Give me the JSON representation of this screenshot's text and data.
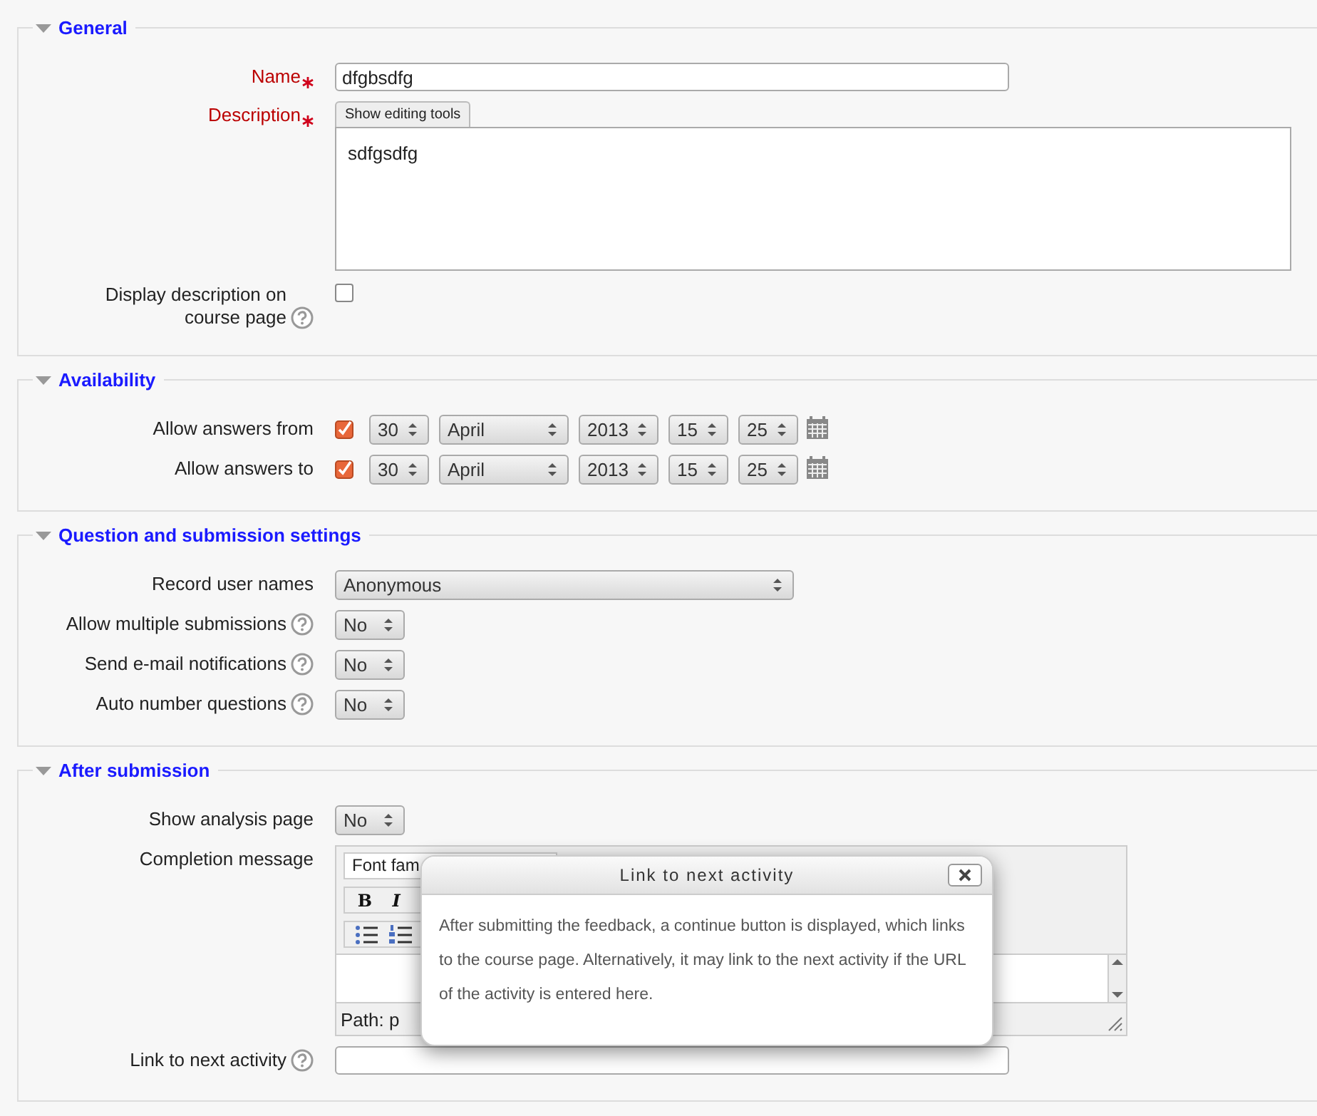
{
  "sections": [
    {
      "title": "General",
      "expanded": true,
      "rows": [
        {
          "kind": "text",
          "label": "Name",
          "required": true,
          "help": false,
          "value": "dfgbsdfg"
        },
        {
          "kind": "editor",
          "label": "Description",
          "required": true,
          "help": false,
          "toggle": "Show editing tools",
          "value": "sdfgsdfg"
        },
        {
          "kind": "checkbox",
          "label": "Display description on course page",
          "required": false,
          "help": true,
          "checked": false
        }
      ]
    },
    {
      "title": "Availability",
      "expanded": true,
      "rows": [
        {
          "kind": "date",
          "label": "Allow answers from",
          "required": false,
          "help": false,
          "checked": true,
          "fields": [
            "30",
            "April",
            "2013",
            "15",
            "25"
          ]
        },
        {
          "kind": "date",
          "label": "Allow answers to",
          "required": false,
          "help": false,
          "checked": true,
          "fields": [
            "30",
            "April",
            "2013",
            "15",
            "25"
          ]
        }
      ]
    },
    {
      "title": "Question and submission settings",
      "expanded": true,
      "rows": [
        {
          "kind": "wideselect",
          "label": "Record user names",
          "required": false,
          "help": false,
          "value": "Anonymous"
        },
        {
          "kind": "select",
          "label": "Allow multiple submissions",
          "required": false,
          "help": true,
          "value": "No"
        },
        {
          "kind": "select",
          "label": "Send e-mail notifications",
          "required": false,
          "help": true,
          "value": "No"
        },
        {
          "kind": "select",
          "label": "Auto number questions",
          "required": false,
          "help": true,
          "value": "No"
        }
      ]
    },
    {
      "title": "After submission",
      "expanded": true,
      "rows": [
        {
          "kind": "select",
          "label": "Show analysis page",
          "required": false,
          "help": false,
          "value": "No"
        },
        {
          "kind": "richtext",
          "label": "Completion message",
          "required": false,
          "help": false,
          "font": "Font fam",
          "tools": [
            "B",
            "I"
          ],
          "path": "Path: p"
        },
        {
          "kind": "text",
          "label": "Link to next activity",
          "required": false,
          "help": true
        }
      ]
    }
  ],
  "popup": {
    "title": "Link to next activity",
    "text": "After submitting the feedback, a continue button is displayed, which links to the course page. Alternatively, it may link to the next activity if the URL of the activity is entered here."
  }
}
